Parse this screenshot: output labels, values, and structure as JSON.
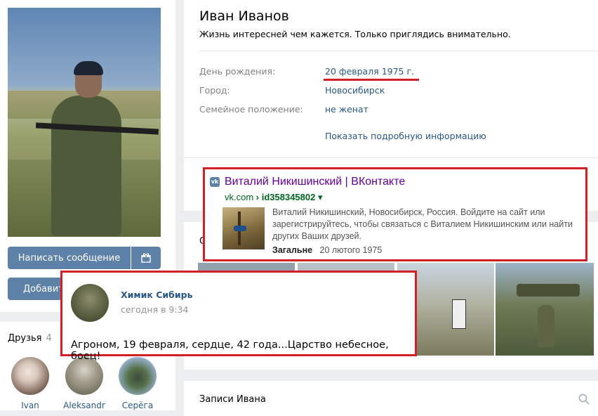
{
  "profile": {
    "name": "Иван Иванов",
    "status": "Жизнь интересней чем кажется. Только приглядись внимательно.",
    "info_rows": [
      {
        "label": "День рождения:",
        "value": "20 февраля 1975 г."
      },
      {
        "label": "Город:",
        "value": "Новосибирск"
      },
      {
        "label": "Семейное положение:",
        "value": "не женат"
      }
    ],
    "more_info_link": "Показать подробную информацию"
  },
  "left": {
    "message_button": "Написать сообщение",
    "add_button": "Добавить",
    "gift_icon": "gift-icon"
  },
  "friends": {
    "title": "Друзья",
    "count": "4",
    "items": [
      {
        "name": "Ivan"
      },
      {
        "name": "Aleksandr"
      },
      {
        "name": "Серёга"
      }
    ]
  },
  "photos_section": {
    "title_fragment": "С"
  },
  "posts": {
    "title": "Записи Ивана",
    "search_icon": "search-icon"
  },
  "google_result": {
    "title": "Виталий Никишинский | ВКонтакте",
    "url_domain": "vk.com",
    "url_path": " › id358345802",
    "url_arrow": " ▾",
    "snippet": "Виталий Никишинский, Новосибирск, Россия. Войдите на сайт или зарегистрируйтесь, чтобы связаться с Виталием Никишинским или найти других Ваших друзей.",
    "meta_label": "Загальне",
    "meta_date": "20 лютого 1975",
    "vk_icon_text": "vk"
  },
  "comment": {
    "author": "Химик Сибирь",
    "time": "сегодня в 9:34",
    "text": "Агроном, 19 февраля, сердце, 42 года...Царство небесное, боец!"
  },
  "colors": {
    "page_bg": "#edeef0",
    "accent": "#5e81a8",
    "link": "#2a5885",
    "highlight_red": "#d32027"
  }
}
